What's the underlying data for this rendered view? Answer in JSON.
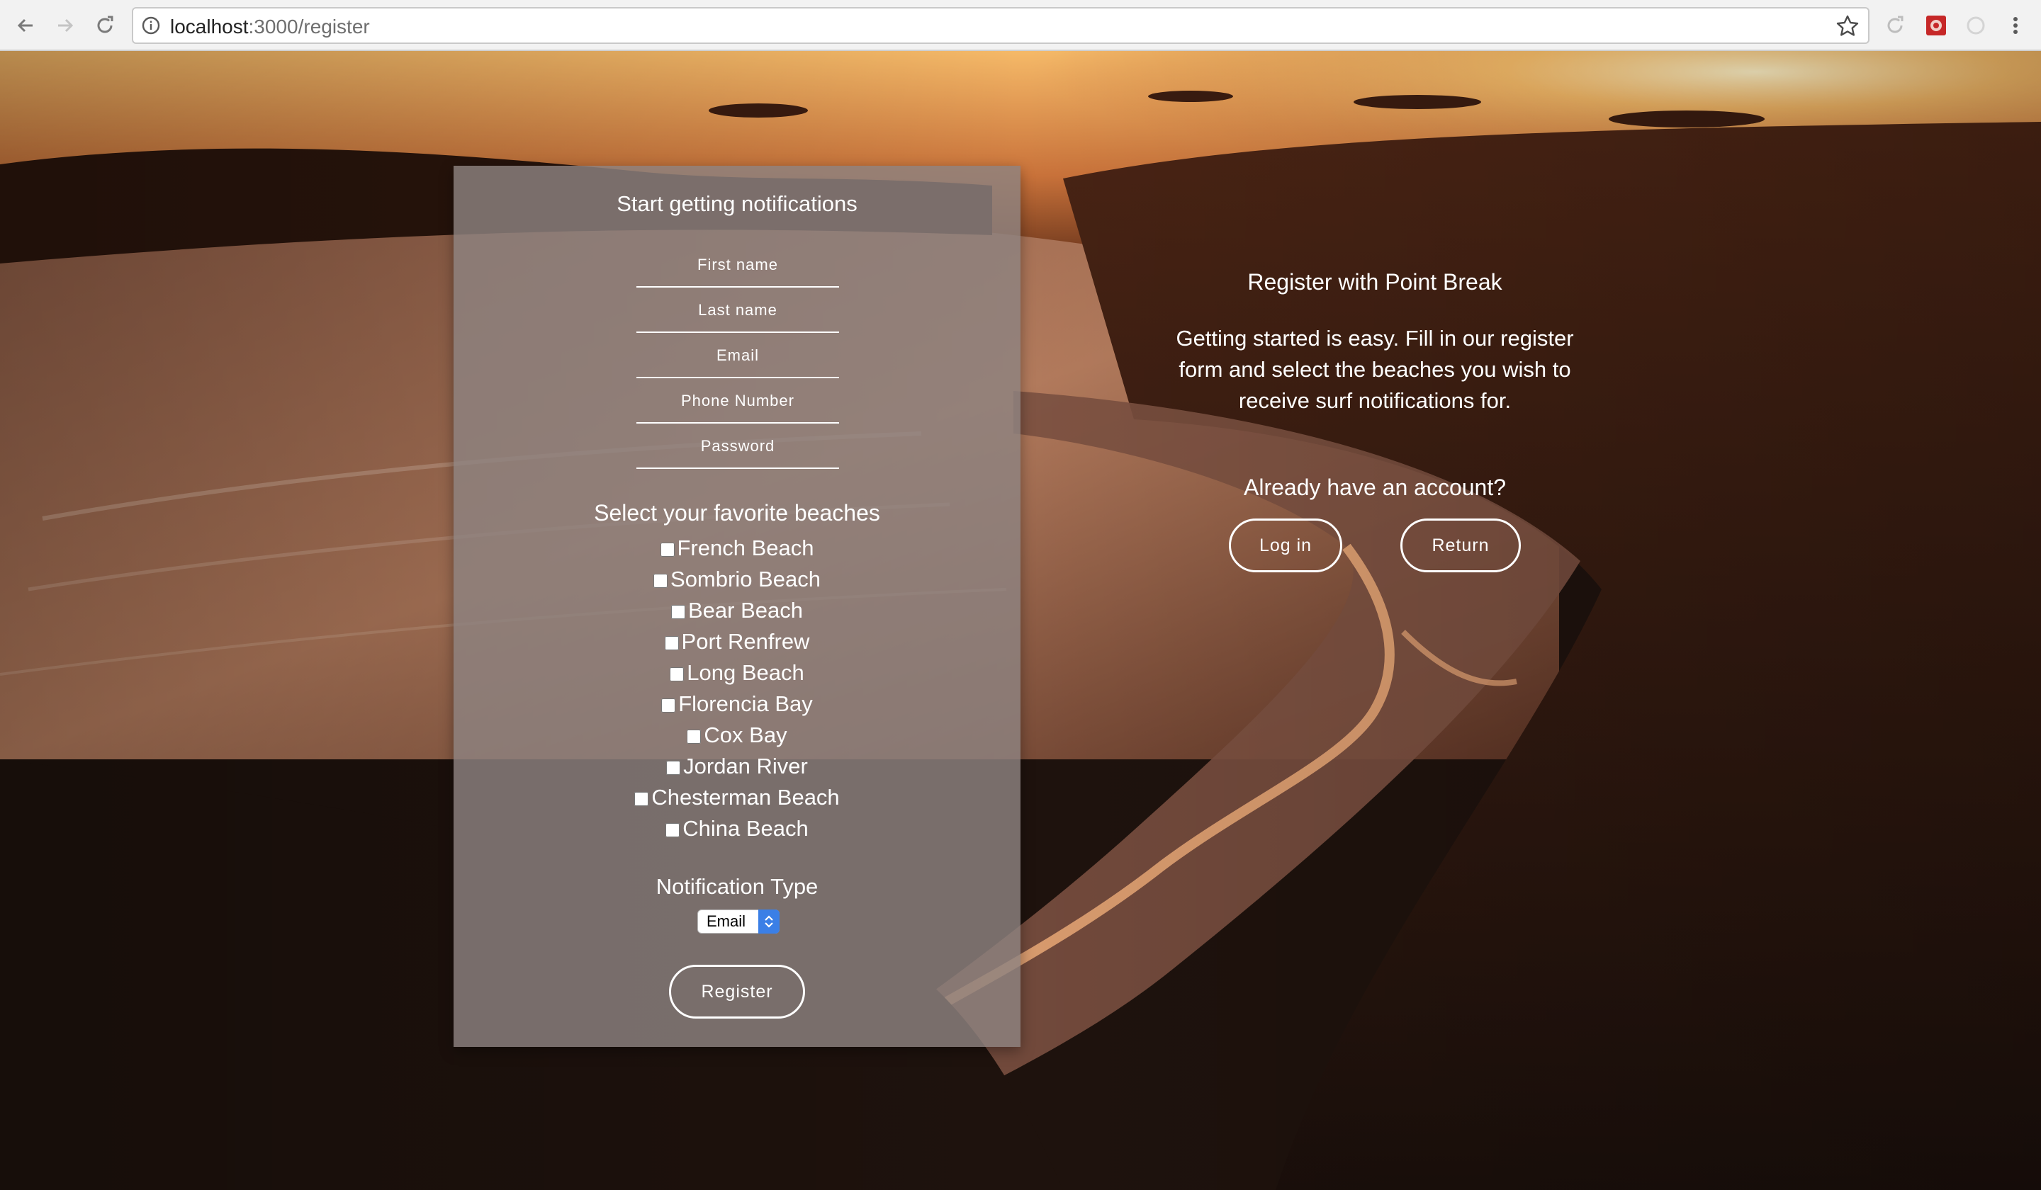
{
  "browser": {
    "url_host": "localhost",
    "url_path": ":3000/register",
    "icons": [
      "back-icon",
      "forward-icon",
      "reload-icon",
      "info-icon",
      "star-icon",
      "extension-icon",
      "menu-icon"
    ]
  },
  "form": {
    "title": "Start getting notifications",
    "fields": {
      "first_name": "First name",
      "last_name": "Last name",
      "email": "Email",
      "phone": "Phone Number",
      "password": "Password"
    },
    "beaches_heading": "Select your favorite beaches",
    "beaches": [
      "French Beach",
      "Sombrio Beach",
      "Bear Beach",
      "Port Renfrew",
      "Long Beach",
      "Florencia Bay",
      "Cox Bay",
      "Jordan River",
      "Chesterman Beach",
      "China Beach"
    ],
    "notification_heading": "Notification Type",
    "notification_selected": "Email",
    "register_label": "Register"
  },
  "info": {
    "title": "Register with Point Break",
    "text": "Getting started is easy. Fill in our register form and select the beaches you wish to receive surf notifications for.",
    "account_question": "Already have an account?",
    "login_label": "Log in",
    "return_label": "Return"
  },
  "colors": {
    "sky_bright": "#f3b25a",
    "sky_dark": "#6b3219",
    "forest": "#1e120d",
    "card_overlay": "#8e8280",
    "select_accent": "#3b7fe6"
  }
}
